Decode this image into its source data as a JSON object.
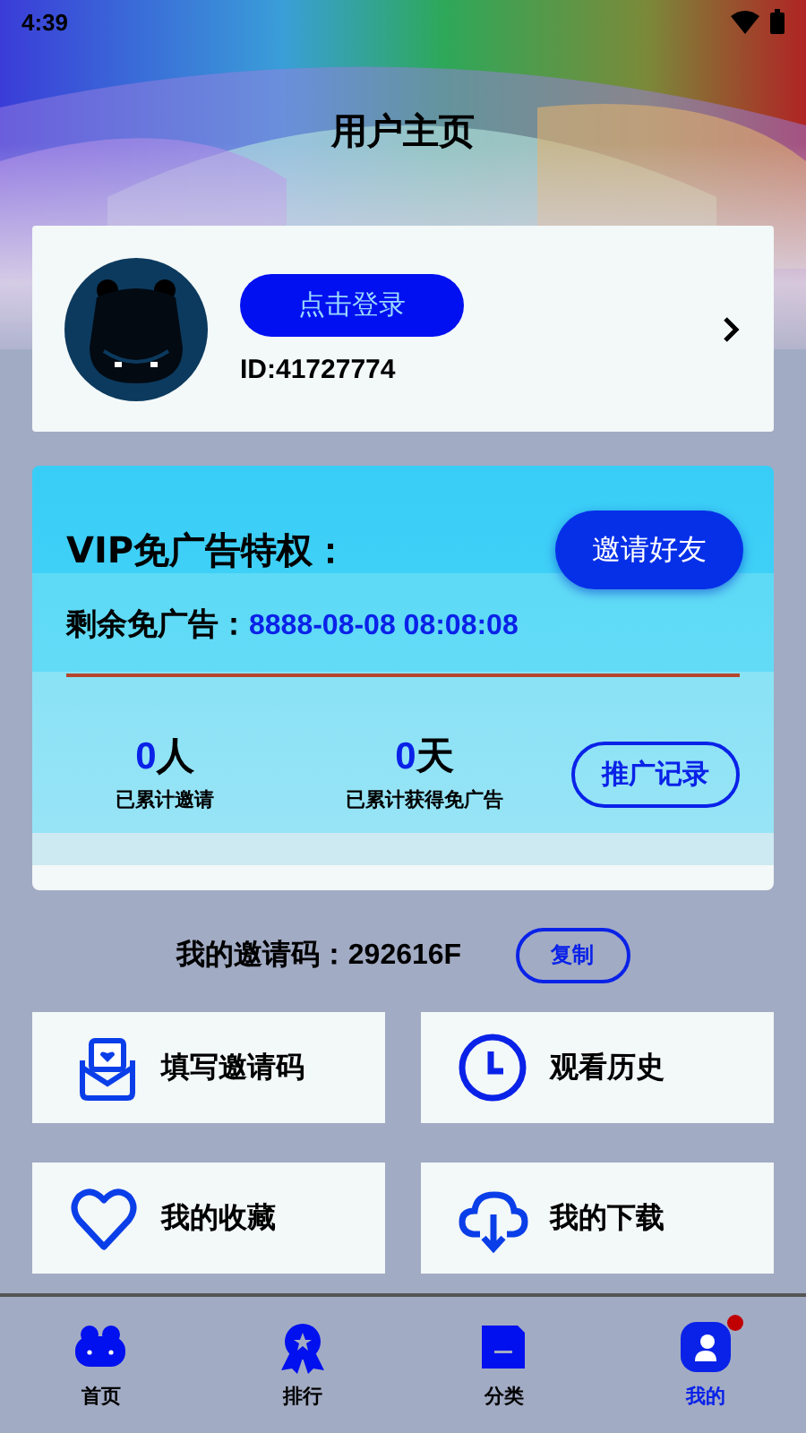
{
  "status_bar": {
    "time": "4:39"
  },
  "title": "用户主页",
  "profile": {
    "login_button": "点击登录",
    "user_id": "ID:41727774"
  },
  "vip": {
    "title": "VIP免广告特权：",
    "invite_button": "邀请好友",
    "remaining_label": "剩余免广告：",
    "remaining_value": "8888-08-08 08:08:08",
    "records_button": "推广记录",
    "stats": [
      {
        "value": "0",
        "unit": "人",
        "label": "已累计邀请"
      },
      {
        "value": "0",
        "unit": "天",
        "label": "已累计获得免广告"
      }
    ]
  },
  "invite_code": {
    "label": "我的邀请码：",
    "code": "292616F",
    "copy_button": "复制"
  },
  "menu": [
    {
      "kind": "envelope",
      "label": "填写邀请码"
    },
    {
      "kind": "clock",
      "label": "观看历史"
    },
    {
      "kind": "heart",
      "label": "我的收藏"
    },
    {
      "kind": "cloud",
      "label": "我的下载"
    }
  ],
  "tabs": [
    {
      "kind": "home",
      "label": "首页",
      "selected": false,
      "notification_dot": false
    },
    {
      "kind": "rank",
      "label": "排行",
      "selected": false,
      "notification_dot": false
    },
    {
      "kind": "category",
      "label": "分类",
      "selected": false,
      "notification_dot": false
    },
    {
      "kind": "me",
      "label": "我的",
      "selected": true,
      "notification_dot": true
    }
  ]
}
